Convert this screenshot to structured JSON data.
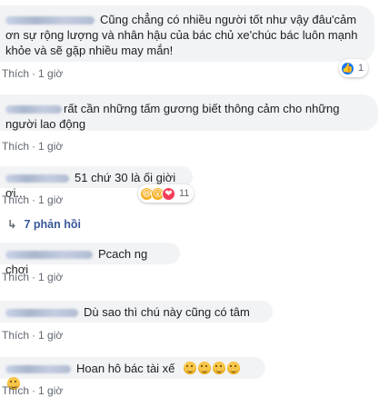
{
  "comments": [
    {
      "text": "Cũng chẳng có nhiều người tốt như vậy đâu'cảm ơn sự rộng lượng và nhân hậu của bác chủ xe'chúc bác luôn mạnh khỏe và sẽ gặp nhiều may mắn!",
      "like_label": "Thích",
      "time": "1 giờ",
      "reaction_count": "1",
      "reactions": [
        "like"
      ]
    },
    {
      "text": "rất cần những tấm gương biết thông cảm cho những người lao động",
      "like_label": "Thích",
      "time": "1 giờ"
    },
    {
      "text": "51 chứ 30 là ối giời ơi...",
      "like_label": "Thích",
      "time": "1 giờ",
      "reaction_count": "11",
      "reactions": [
        "haha",
        "wow",
        "love"
      ]
    },
    {
      "text": "Pcach ng chơi",
      "like_label": "Thích",
      "time": "1 giờ"
    },
    {
      "text": "Dù sao thì chú này cũng có tâm",
      "like_label": "Thích",
      "time": "1 giờ"
    },
    {
      "text": "Hoan hô bác tài xế",
      "like_label": "Thích",
      "time": "1 giờ",
      "emoji_count": 5
    }
  ],
  "replies_link": "7 phản hồi",
  "colors": {
    "link": "#385898",
    "bubble": "#f2f3f5",
    "like_blue": "#1877f2"
  }
}
